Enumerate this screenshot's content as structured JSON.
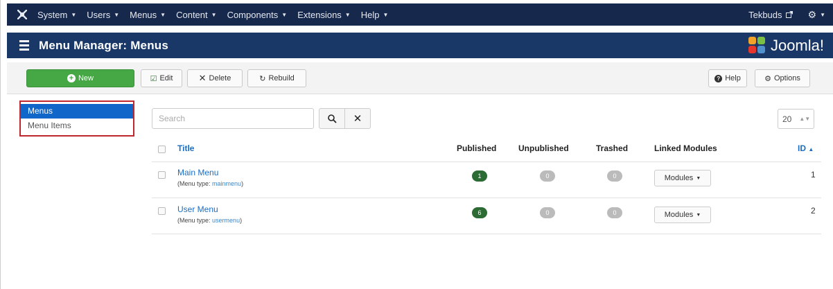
{
  "topnav": {
    "menus": [
      {
        "label": "System"
      },
      {
        "label": "Users"
      },
      {
        "label": "Menus"
      },
      {
        "label": "Content"
      },
      {
        "label": "Components"
      },
      {
        "label": "Extensions"
      },
      {
        "label": "Help"
      }
    ],
    "site_name": "Tekbuds"
  },
  "header": {
    "title": "Menu Manager: Menus",
    "logo_text": "Joomla!"
  },
  "toolbar": {
    "new_label": "New",
    "edit_label": "Edit",
    "delete_label": "Delete",
    "rebuild_label": "Rebuild",
    "help_label": "Help",
    "options_label": "Options"
  },
  "sidebar": {
    "items": [
      {
        "label": "Menus",
        "active": true
      },
      {
        "label": "Menu Items",
        "active": false
      }
    ]
  },
  "filter": {
    "search_placeholder": "Search",
    "limit_value": "20"
  },
  "table": {
    "headers": {
      "title": "Title",
      "published": "Published",
      "unpublished": "Unpublished",
      "trashed": "Trashed",
      "linked_modules": "Linked Modules",
      "id": "ID"
    },
    "rows": [
      {
        "title": "Main Menu",
        "menu_type_prefix": "(Menu type:",
        "menu_type": "mainmenu",
        "menu_type_suffix": ")",
        "published": "1",
        "unpublished": "0",
        "trashed": "0",
        "modules_label": "Modules",
        "id": "1"
      },
      {
        "title": "User Menu",
        "menu_type_prefix": "(Menu type:",
        "menu_type": "usermenu",
        "menu_type_suffix": ")",
        "published": "6",
        "unpublished": "0",
        "trashed": "0",
        "modules_label": "Modules",
        "id": "2"
      }
    ]
  },
  "colors": {
    "topnav_bg": "#17284d",
    "titlebar_bg": "#1a3867",
    "new_button": "#45a845",
    "published_badge": "#2c6b33",
    "active_sidebar": "#1166c9",
    "highlight_border": "#c0272d"
  }
}
